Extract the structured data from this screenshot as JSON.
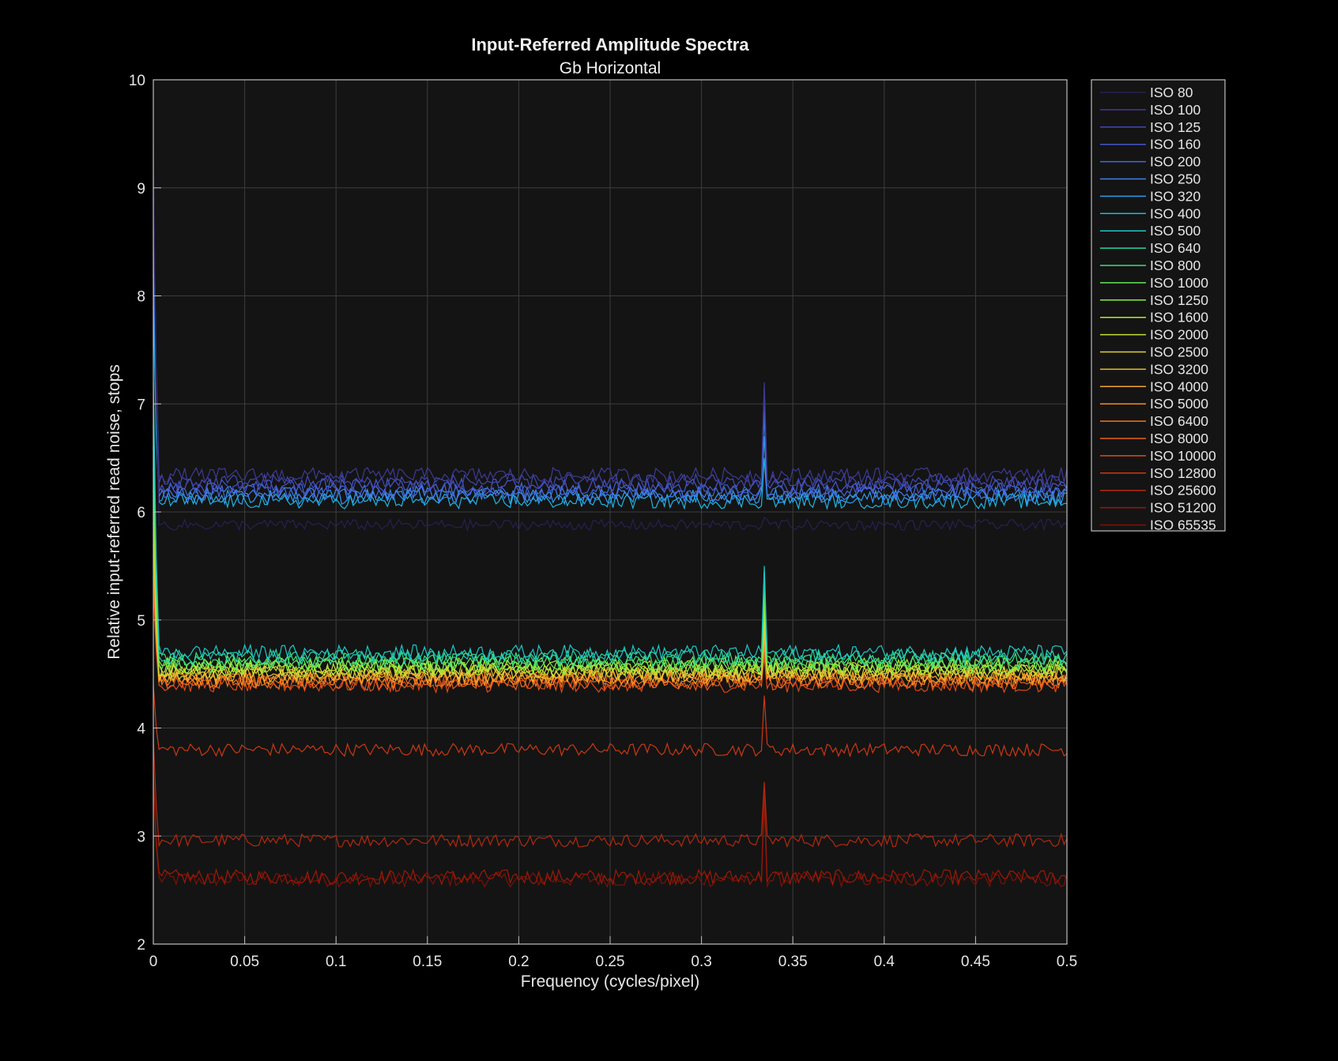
{
  "chart_data": {
    "type": "line",
    "title": "Input-Referred Amplitude Spectra",
    "subtitle": "Gb Horizontal",
    "xlabel": "Frequency (cycles/pixel)",
    "ylabel": "Relative input-referred read noise, stops",
    "xlim": [
      0,
      0.5
    ],
    "ylim": [
      2,
      10
    ],
    "x_ticks": [
      "0",
      "0.05",
      "0.1",
      "0.15",
      "0.2",
      "0.25",
      "0.3",
      "0.35",
      "0.4",
      "0.45",
      "0.5"
    ],
    "y_ticks": [
      "2",
      "3",
      "4",
      "5",
      "6",
      "7",
      "8",
      "9",
      "10"
    ],
    "grid": true,
    "legend_position": "outside-right",
    "background": "#141414",
    "spike_x": 0.334,
    "series": [
      {
        "name": "ISO 80",
        "color": "#2a1f52",
        "level": 5.88,
        "dc": 9.4,
        "spike": 5.95,
        "jitter": 0.05
      },
      {
        "name": "ISO 100",
        "color": "#3d3a95",
        "level": 6.34,
        "dc": 9.2,
        "spike": 7.2,
        "jitter": 0.07
      },
      {
        "name": "ISO 125",
        "color": "#4348b0",
        "level": 6.28,
        "dc": 9.1,
        "spike": 7.15,
        "jitter": 0.07
      },
      {
        "name": "ISO 160",
        "color": "#4656cc",
        "level": 6.24,
        "dc": 9.0,
        "spike": 7.1,
        "jitter": 0.07
      },
      {
        "name": "ISO 200",
        "color": "#4568e0",
        "level": 6.2,
        "dc": 8.9,
        "spike": 7.0,
        "jitter": 0.07
      },
      {
        "name": "ISO 250",
        "color": "#3f80f0",
        "level": 6.17,
        "dc": 8.6,
        "spike": 6.9,
        "jitter": 0.07
      },
      {
        "name": "ISO 320",
        "color": "#2f9cf2",
        "level": 6.14,
        "dc": 8.2,
        "spike": 6.7,
        "jitter": 0.07
      },
      {
        "name": "ISO 400",
        "color": "#1fb6e0",
        "level": 6.1,
        "dc": 7.9,
        "spike": 6.5,
        "jitter": 0.07
      },
      {
        "name": "ISO 500",
        "color": "#1ac9c6",
        "level": 4.7,
        "dc": 7.2,
        "spike": 5.5,
        "jitter": 0.07
      },
      {
        "name": "ISO 640",
        "color": "#28d5a4",
        "level": 4.66,
        "dc": 7.0,
        "spike": 5.45,
        "jitter": 0.07
      },
      {
        "name": "ISO 800",
        "color": "#3edf7c",
        "level": 4.63,
        "dc": 6.8,
        "spike": 5.4,
        "jitter": 0.07
      },
      {
        "name": "ISO 1000",
        "color": "#63e85a",
        "level": 4.6,
        "dc": 6.6,
        "spike": 5.3,
        "jitter": 0.07
      },
      {
        "name": "ISO 1250",
        "color": "#8cee3f",
        "level": 4.58,
        "dc": 6.4,
        "spike": 5.2,
        "jitter": 0.07
      },
      {
        "name": "ISO 1600",
        "color": "#aeea34",
        "level": 4.56,
        "dc": 6.2,
        "spike": 5.1,
        "jitter": 0.07
      },
      {
        "name": "ISO 2000",
        "color": "#c8e035",
        "level": 4.54,
        "dc": 6.0,
        "spike": 5.0,
        "jitter": 0.07
      },
      {
        "name": "ISO 2500",
        "color": "#ddd035",
        "level": 4.52,
        "dc": 5.9,
        "spike": 4.95,
        "jitter": 0.07
      },
      {
        "name": "ISO 3200",
        "color": "#ecbb30",
        "level": 4.5,
        "dc": 5.8,
        "spike": 4.9,
        "jitter": 0.07
      },
      {
        "name": "ISO 4000",
        "color": "#f4a32a",
        "level": 4.48,
        "dc": 5.7,
        "spike": 4.85,
        "jitter": 0.07
      },
      {
        "name": "ISO 5000",
        "color": "#f88b24",
        "level": 4.46,
        "dc": 5.6,
        "spike": 4.8,
        "jitter": 0.07
      },
      {
        "name": "ISO 6400",
        "color": "#f5731e",
        "level": 4.44,
        "dc": 5.5,
        "spike": 4.75,
        "jitter": 0.07
      },
      {
        "name": "ISO 8000",
        "color": "#ec5e1a",
        "level": 4.42,
        "dc": 5.4,
        "spike": 4.7,
        "jitter": 0.07
      },
      {
        "name": "ISO 10000",
        "color": "#de4a16",
        "level": 4.4,
        "dc": 5.3,
        "spike": 4.65,
        "jitter": 0.07
      },
      {
        "name": "ISO 12800",
        "color": "#cc3812",
        "level": 3.8,
        "dc": 4.4,
        "spike": 4.3,
        "jitter": 0.06
      },
      {
        "name": "ISO 25600",
        "color": "#b5280d",
        "level": 2.96,
        "dc": 3.9,
        "spike": 3.5,
        "jitter": 0.06
      },
      {
        "name": "ISO 51200",
        "color": "#9a1a08",
        "level": 2.62,
        "dc": 3.6,
        "spike": 3.45,
        "jitter": 0.07
      },
      {
        "name": "ISO 65535",
        "color": "#7e1004",
        "level": 2.6,
        "dc": 3.5,
        "spike": 3.3,
        "jitter": 0.07
      }
    ]
  }
}
